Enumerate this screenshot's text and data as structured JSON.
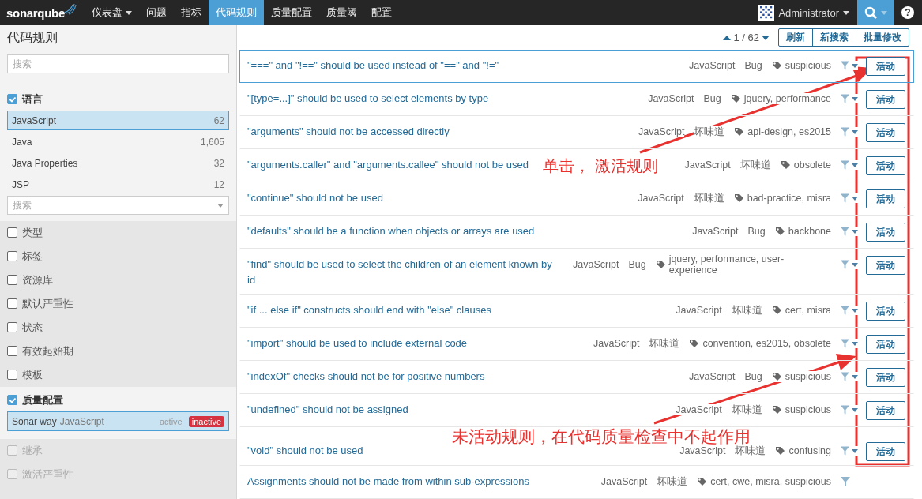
{
  "navbar": {
    "logo": "sonarqube",
    "items": [
      {
        "label": "仪表盘",
        "selected": false,
        "dropdown": true
      },
      {
        "label": "问题",
        "selected": false,
        "dropdown": false
      },
      {
        "label": "指标",
        "selected": false,
        "dropdown": false
      },
      {
        "label": "代码规则",
        "selected": true,
        "dropdown": false
      },
      {
        "label": "质量配置",
        "selected": false,
        "dropdown": false
      },
      {
        "label": "质量阈",
        "selected": false,
        "dropdown": false
      },
      {
        "label": "配置",
        "selected": false,
        "dropdown": false
      }
    ],
    "user": "Administrator",
    "help": "?"
  },
  "sidebar": {
    "title": "代码规则",
    "search": {
      "placeholder": "搜索"
    },
    "facets": [
      {
        "kind": "list",
        "label": "语言",
        "checked": true,
        "expanded": true,
        "disabled": false,
        "items": [
          {
            "name": "JavaScript",
            "count": "62",
            "selected": true
          },
          {
            "name": "Java",
            "count": "1,605",
            "selected": false
          },
          {
            "name": "Java Properties",
            "count": "32",
            "selected": false
          },
          {
            "name": "JSP",
            "count": "12",
            "selected": false
          }
        ],
        "select": {
          "placeholder": "搜索"
        }
      },
      {
        "kind": "plain",
        "label": "类型",
        "checked": false,
        "expanded": false,
        "disabled": false
      },
      {
        "kind": "plain",
        "label": "标签",
        "checked": false,
        "expanded": false,
        "disabled": false
      },
      {
        "kind": "plain",
        "label": "资源库",
        "checked": false,
        "expanded": false,
        "disabled": false
      },
      {
        "kind": "plain",
        "label": "默认严重性",
        "checked": false,
        "expanded": false,
        "disabled": false
      },
      {
        "kind": "plain",
        "label": "状态",
        "checked": false,
        "expanded": false,
        "disabled": false
      },
      {
        "kind": "plain",
        "label": "有效起始期",
        "checked": false,
        "expanded": false,
        "disabled": false
      },
      {
        "kind": "plain",
        "label": "模板",
        "checked": false,
        "expanded": false,
        "disabled": false
      },
      {
        "kind": "profile",
        "label": "质量配置",
        "checked": true,
        "expanded": true,
        "disabled": false,
        "profile": {
          "name": "Sonar way",
          "language": "JavaScript",
          "selected": true,
          "options": [
            {
              "label": "active",
              "selected": false
            },
            {
              "label": "inactive",
              "selected": true
            }
          ]
        }
      },
      {
        "kind": "plain",
        "label": "继承",
        "checked": false,
        "expanded": false,
        "disabled": true
      },
      {
        "kind": "plain",
        "label": "激活严重性",
        "checked": false,
        "expanded": false,
        "disabled": true
      }
    ]
  },
  "main": {
    "pager": "1 / 62",
    "buttons": [
      "刷新",
      "新搜索",
      "批量修改"
    ],
    "rules": [
      {
        "title": "\"===\" and \"!==\" should be used instead of \"==\" and \"!=\"",
        "language": "JavaScript",
        "type": "Bug",
        "tags": "suspicious",
        "selected": true,
        "button": "活动"
      },
      {
        "title": "\"[type=...]\" should be used to select elements by type",
        "language": "JavaScript",
        "type": "Bug",
        "tags": "jquery, performance",
        "selected": false,
        "button": "活动"
      },
      {
        "title": "\"arguments\" should not be accessed directly",
        "language": "JavaScript",
        "type": "坏味道",
        "tags": "api-design, es2015",
        "selected": false,
        "button": "活动"
      },
      {
        "title": "\"arguments.caller\" and \"arguments.callee\" should not be used",
        "language": "JavaScript",
        "type": "坏味道",
        "tags": "obsolete",
        "selected": false,
        "button": "活动"
      },
      {
        "title": "\"continue\" should not be used",
        "language": "JavaScript",
        "type": "坏味道",
        "tags": "bad-practice, misra",
        "selected": false,
        "button": "活动"
      },
      {
        "title": "\"defaults\" should be a function when objects or arrays are used",
        "language": "JavaScript",
        "type": "Bug",
        "tags": "backbone",
        "selected": false,
        "button": "活动"
      },
      {
        "title": "\"find\" should be used to select the children of an element known by id",
        "language": "JavaScript",
        "type": "Bug",
        "tags": "jquery, performance, user-experience",
        "selected": false,
        "button": "活动"
      },
      {
        "title": "\"if ... else if\" constructs should end with \"else\" clauses",
        "language": "JavaScript",
        "type": "坏味道",
        "tags": "cert, misra",
        "selected": false,
        "button": "活动"
      },
      {
        "title": "\"import\" should be used to include external code",
        "language": "JavaScript",
        "type": "坏味道",
        "tags": "convention, es2015, obsolete",
        "selected": false,
        "button": "活动"
      },
      {
        "title": "\"indexOf\" checks should not be for positive numbers",
        "language": "JavaScript",
        "type": "Bug",
        "tags": "suspicious",
        "selected": false,
        "button": "活动"
      },
      {
        "title": "\"undefined\" should not be assigned",
        "language": "JavaScript",
        "type": "坏味道",
        "tags": "suspicious",
        "selected": false,
        "button": "活动"
      },
      {
        "title": "\"void\" should not be used",
        "language": "JavaScript",
        "type": "坏味道",
        "tags": "confusing",
        "selected": false,
        "button": "活动"
      },
      {
        "title": "Assignments should not be made from within sub-expressions",
        "language": "JavaScript",
        "type": "坏味道",
        "tags": "cert, cwe, misra, suspicious",
        "selected": false
      }
    ]
  },
  "annotations": [
    {
      "text": "单击， 激活规则"
    },
    {
      "text": "未活动规则，在代码质量检查中不起作用"
    }
  ]
}
